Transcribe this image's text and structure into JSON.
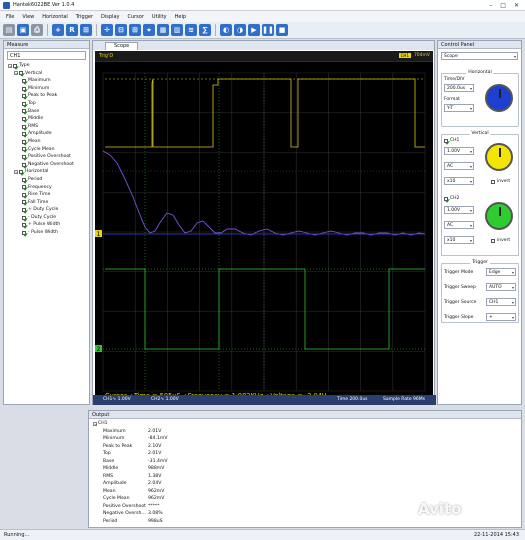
{
  "window": {
    "title": "Hantek6022BE Ver 1.0.4"
  },
  "menu": [
    "File",
    "View",
    "Horizontal",
    "Trigger",
    "Display",
    "Cursor",
    "Utility",
    "Help"
  ],
  "measure": {
    "header": "Measure",
    "channel": "CH1",
    "tree": {
      "root": "Type",
      "vertical": {
        "label": "Vertical",
        "items": [
          "Maximum",
          "Minimum",
          "Peak to Peak",
          "Top",
          "Base",
          "Middle",
          "RMS",
          "Amplitude",
          "Mean",
          "Cycle Mean",
          "Positive Overshoot",
          "Negative Overshoot"
        ]
      },
      "horizontal": {
        "label": "Horizontal",
        "items": [
          "Period",
          "Frequency",
          "Rise Time",
          "Fall Time",
          "+ Duty Cycle",
          "- Duty Cycle",
          "+ Pulse Width",
          "- Pulse Width"
        ]
      }
    }
  },
  "scope": {
    "tab": "Scope",
    "trig_status": "Trig'D",
    "trig_tag": "CH1",
    "trig_level": "704mV",
    "cursor_readout": "Cursor  △Time = 505uS  △Frequency = 1.982KHz  △Voltage = -2.04V",
    "bottom": {
      "ch1": "CH1∿  1.00V",
      "ch2": "CH2∿  1.00V",
      "time": "Time 200.0us",
      "rate": "Sample Rate 96Ms"
    },
    "ch1_marker": "1",
    "ch2_marker": "2"
  },
  "control": {
    "header": "Control Panel",
    "mode": "Scope",
    "horizontal": {
      "title": "Horizontal",
      "timediv_label": "Time/DIV",
      "timediv": "200.0us",
      "format_label": "Format",
      "format": "Y-T"
    },
    "vertical": {
      "title": "Vertical",
      "ch1_label": "CH1",
      "ch1_volt": "1.00V",
      "ch1_coupling": "AC",
      "ch1_probe": "x10",
      "ch2_label": "CH2",
      "ch2_volt": "1.00V",
      "ch2_coupling": "AC",
      "ch2_probe": "x10",
      "invert": "invert"
    },
    "trigger": {
      "title": "Trigger",
      "mode_label": "Trigger Mode",
      "mode": "Edge",
      "sweep_label": "Trigger Sweep",
      "sweep": "AUTO",
      "source_label": "Trigger Source",
      "source": "CH1",
      "slope_label": "Trigger Slope",
      "slope": "+"
    },
    "knob_colors": {
      "horizontal": "#1f3fd0",
      "ch1": "#f2e600",
      "ch2": "#2ecc2e"
    }
  },
  "output": {
    "header": "Output",
    "channel": "CH1",
    "rows": [
      {
        "k": "Maximum",
        "v": "2.01V"
      },
      {
        "k": "Minimum",
        "v": "-84.1mV"
      },
      {
        "k": "Peak to Peak",
        "v": "2.10V"
      },
      {
        "k": "Top",
        "v": "2.01V"
      },
      {
        "k": "Base",
        "v": "-31.4mV"
      },
      {
        "k": "Middle",
        "v": "988mV"
      },
      {
        "k": "RMS",
        "v": "1.38V"
      },
      {
        "k": "Amplitude",
        "v": "2.04V"
      },
      {
        "k": "Mean",
        "v": "962mV"
      },
      {
        "k": "Cycle Mean",
        "v": "962mV"
      },
      {
        "k": "Positive Overshoot",
        "v": "*****"
      },
      {
        "k": "Negative Oversh...",
        "v": "3.08%"
      },
      {
        "k": "Period",
        "v": "998uS"
      }
    ]
  },
  "status": {
    "left": "Running...",
    "right": "22-11-2014  15:43"
  },
  "watermark": "Avito"
}
